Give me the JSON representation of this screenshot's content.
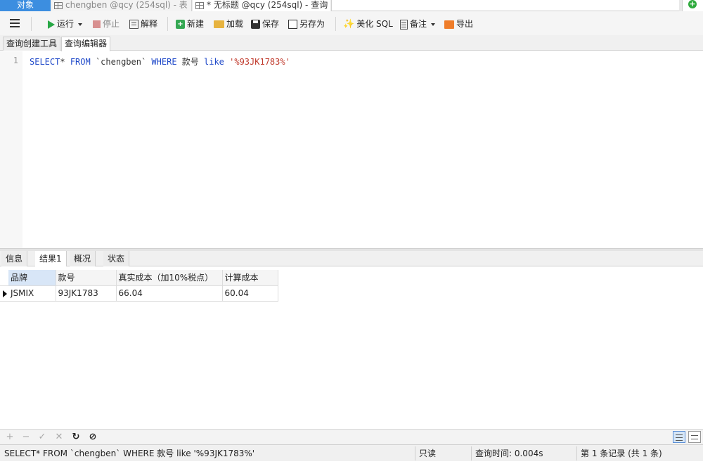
{
  "tabs": {
    "objects": "对象",
    "table": "chengben @qcy (254sql) - 表",
    "query": "* 无标题 @qcy (254sql) - 查询"
  },
  "toolbar": {
    "run": "运行",
    "stop": "停止",
    "explain": "解释",
    "new": "新建",
    "load": "加载",
    "save": "保存",
    "save_as": "另存为",
    "beautify": "美化 SQL",
    "notes": "备注",
    "export": "导出"
  },
  "editor_tabs": {
    "builder": "查询创建工具",
    "editor": "查询编辑器"
  },
  "editor": {
    "line_number": "1",
    "sql_select": "SELECT",
    "sql_star": "* ",
    "sql_from": "FROM",
    "sql_table": " `chengben` ",
    "sql_where": "WHERE",
    "sql_field": " 款号 ",
    "sql_like": "like",
    "sql_value": " '%93JK1783%'"
  },
  "result_tabs": {
    "info": "信息",
    "result1": "结果1",
    "overview": "概况",
    "status": "状态"
  },
  "grid": {
    "columns": [
      "品牌",
      "款号",
      "真实成本（加10%税点）",
      "计算成本"
    ],
    "rows": [
      [
        "JSMIX",
        "93JK1783",
        "66.04",
        "60.04"
      ]
    ]
  },
  "status": {
    "query": "SELECT* FROM `chengben` WHERE 款号 like '%93JK1783%'",
    "mode": "只读",
    "time": "查询时间: 0.004s",
    "records": "第 1 条记录 (共 1 条)"
  },
  "icons": {
    "run": "play-icon",
    "stop": "stop-icon",
    "explain": "explain-icon",
    "new": "new-query-icon",
    "load": "folder-icon",
    "save": "floppy-icon",
    "save_as": "save-as-icon",
    "beautify": "magic-wand-icon",
    "notes": "notes-icon",
    "export": "export-icon"
  },
  "colors": {
    "accent": "#3c8ee0",
    "keyword": "#1f49c9",
    "string": "#c0392b",
    "run_green": "#28a745"
  }
}
